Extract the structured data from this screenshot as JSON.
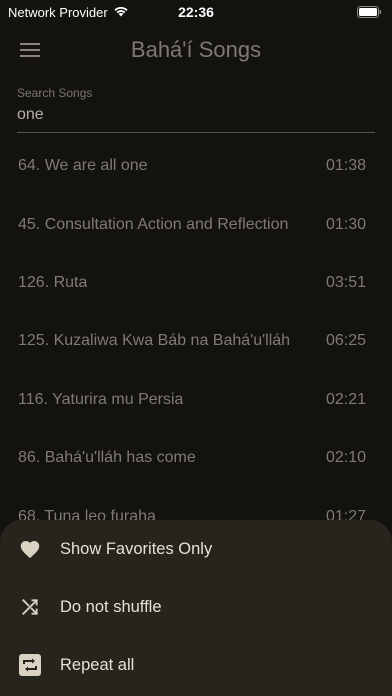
{
  "status_bar": {
    "carrier": "Network Provider",
    "time": "22:36",
    "wifi_icon": "wifi-icon",
    "battery_icon": "battery-icon"
  },
  "app_bar": {
    "title": "Bahá'í Songs",
    "menu_icon": "hamburger-menu-icon"
  },
  "search": {
    "label": "Search Songs",
    "value": "one"
  },
  "songs": [
    {
      "title": "64. We are all one",
      "duration": "01:38"
    },
    {
      "title": "45. Consultation Action and Reflection",
      "duration": "01:30"
    },
    {
      "title": "126. Ruta",
      "duration": "03:51"
    },
    {
      "title": "125. Kuzaliwa Kwa Báb na Bahá'u'lláh",
      "duration": "06:25"
    },
    {
      "title": "116. Yaturira mu Persia",
      "duration": "02:21"
    },
    {
      "title": "86. Bahá'u'lláh has come",
      "duration": "02:10"
    },
    {
      "title": "68. Tuna leo furaha",
      "duration": "01:27"
    }
  ],
  "bottom_sheet": {
    "items": [
      {
        "label": "Show Favorites Only",
        "icon": "heart-icon"
      },
      {
        "label": "Do not shuffle",
        "icon": "shuffle-off-icon"
      },
      {
        "label": "Repeat all",
        "icon": "repeat-icon"
      }
    ]
  },
  "colors": {
    "background": "#13120f",
    "sheet": "#27241e",
    "icon": "#d9d1c1"
  }
}
